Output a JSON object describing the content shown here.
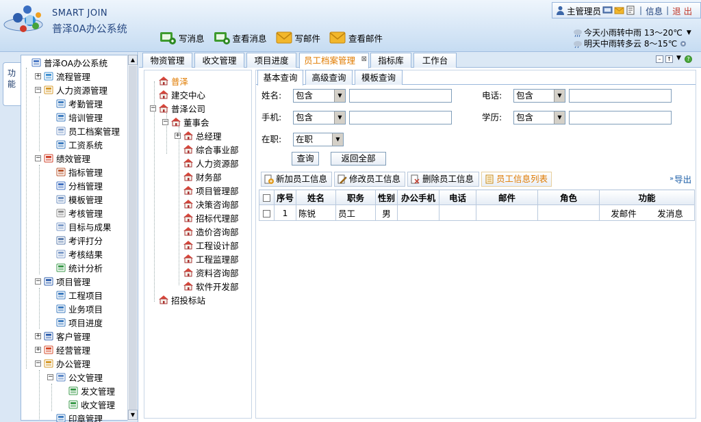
{
  "header": {
    "brand": "SMART JOIN",
    "product": "普泽0A办公系统",
    "toolbar": [
      {
        "label": "写消息",
        "icon": "write-message-icon"
      },
      {
        "label": "查看消息",
        "icon": "view-message-icon"
      },
      {
        "label": "写邮件",
        "icon": "write-mail-icon"
      },
      {
        "label": "查看邮件",
        "icon": "view-mail-icon"
      }
    ],
    "user": "主管理员",
    "info": "信息",
    "logout": "退 出",
    "weather_today": "今天小雨转中雨 13～20℃",
    "weather_tomorrow": "明天中雨转多云 8～15℃"
  },
  "sidebar": {
    "tab_label_1": "功",
    "tab_label_2": "能",
    "items": [
      {
        "label": "普泽OA办公系统",
        "icon": "db-icon"
      },
      {
        "label": "流程管理",
        "icon": "flow-icon"
      },
      {
        "label": "人力资源管理",
        "icon": "people-icon"
      },
      {
        "label": "考勤管理",
        "icon": "table-icon"
      },
      {
        "label": "培训管理",
        "icon": "table-icon"
      },
      {
        "label": "员工档案管理",
        "icon": "doc-icon"
      },
      {
        "label": "工资系统",
        "icon": "table-icon"
      },
      {
        "label": "绩效管理",
        "icon": "target-icon"
      },
      {
        "label": "指标管理",
        "icon": "book-icon"
      },
      {
        "label": "分档管理",
        "icon": "cubes-icon"
      },
      {
        "label": "模板管理",
        "icon": "form-icon"
      },
      {
        "label": "考核管理",
        "icon": "wrench-icon"
      },
      {
        "label": "目标与成果",
        "icon": "doc-icon"
      },
      {
        "label": "考评打分",
        "icon": "percent-icon"
      },
      {
        "label": "考核结果",
        "icon": "doc-icon"
      },
      {
        "label": "统计分析",
        "icon": "chart-icon"
      },
      {
        "label": "项目管理",
        "icon": "person-icon"
      },
      {
        "label": "工程项目",
        "icon": "table-icon"
      },
      {
        "label": "业务项目",
        "icon": "table-icon"
      },
      {
        "label": "项目进度",
        "icon": "table-icon"
      },
      {
        "label": "客户管理",
        "icon": "person-icon"
      },
      {
        "label": "经营管理",
        "icon": "shapes-icon"
      },
      {
        "label": "办公管理",
        "icon": "people-icon"
      },
      {
        "label": "公文管理",
        "icon": "folder-icon"
      },
      {
        "label": "发文管理",
        "icon": "send-doc-icon"
      },
      {
        "label": "收文管理",
        "icon": "receive-doc-icon"
      },
      {
        "label": "印章管理",
        "icon": "table-icon"
      }
    ]
  },
  "tabs": [
    {
      "label": "物资管理",
      "active": false
    },
    {
      "label": "收文管理",
      "active": false
    },
    {
      "label": "项目进度",
      "active": false
    },
    {
      "label": "员工档案管理",
      "active": true
    },
    {
      "label": "指标库",
      "active": false
    },
    {
      "label": "工作台",
      "active": false
    }
  ],
  "tab_close": "⊠",
  "org_tree": [
    {
      "label": "普泽",
      "selected": true
    },
    {
      "label": "建交中心"
    },
    {
      "label": "普泽公司"
    },
    {
      "label": "董事会"
    },
    {
      "label": "总经理"
    },
    {
      "label": "综合事业部"
    },
    {
      "label": "人力资源部"
    },
    {
      "label": "财务部"
    },
    {
      "label": "项目管理部"
    },
    {
      "label": "决策咨询部"
    },
    {
      "label": "招标代理部"
    },
    {
      "label": "造价咨询部"
    },
    {
      "label": "工程设计部"
    },
    {
      "label": "工程监理部"
    },
    {
      "label": "资料咨询部"
    },
    {
      "label": "软件开发部"
    },
    {
      "label": "招投标站"
    }
  ],
  "query_tabs": [
    "基本查询",
    "高级查询",
    "模板查询"
  ],
  "form": {
    "name_label": "姓名:",
    "name_op": "包含",
    "phone_label": "电话:",
    "phone_op": "包含",
    "mobile_label": "手机:",
    "mobile_op": "包含",
    "edu_label": "学历:",
    "edu_op": "包含",
    "status_label": "在职:",
    "status_value": "在职",
    "query_btn": "查询",
    "reset_btn": "返回全部"
  },
  "actions": {
    "add": "新加员工信息",
    "edit": "修改员工信息",
    "delete": "删除员工信息",
    "list": "员工信息列表",
    "export": "导出"
  },
  "table": {
    "headers": [
      "",
      "序号",
      "姓名",
      "职务",
      "性别",
      "办公手机",
      "电话",
      "邮件",
      "角色",
      "功能"
    ],
    "rows": [
      {
        "no": "1",
        "name": "陈锐",
        "title": "员工",
        "gender": "男",
        "mobile": "",
        "phone": "",
        "email": "",
        "role": "",
        "send_mail": "发邮件",
        "send_msg": "发消息"
      }
    ]
  },
  "colors": {
    "accent": "#e07b00",
    "link": "#1d5fa8",
    "border": "#9ab8dc"
  }
}
